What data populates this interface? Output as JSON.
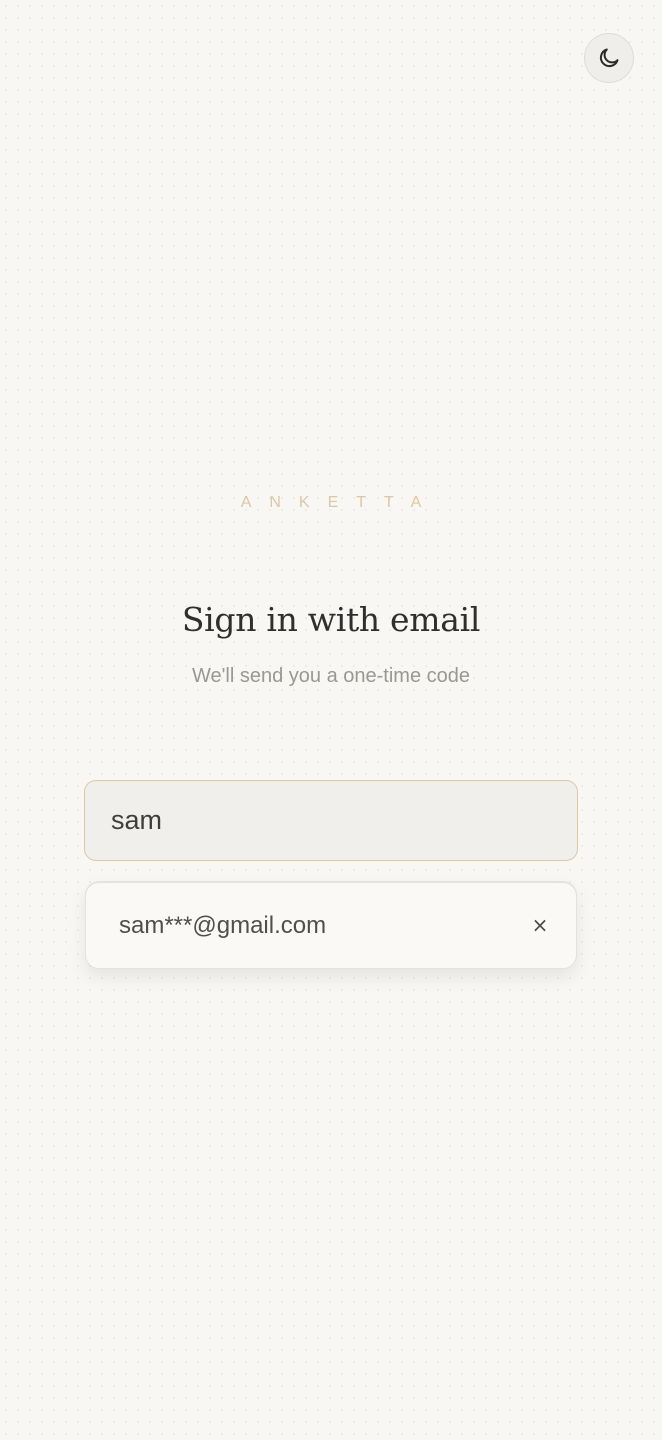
{
  "header": {
    "theme_toggle_icon": "moon-icon"
  },
  "brand": {
    "name": "ANKETTA",
    "color": "#ddc8a5"
  },
  "signin": {
    "title": "Sign in with email",
    "subtitle": "We'll send you a one-time code"
  },
  "email_input": {
    "value": "sam"
  },
  "suggestions": {
    "items": [
      {
        "label": "sam***@gmail.com",
        "remove_label": "×",
        "remove_icon": "close-icon"
      }
    ]
  },
  "colors": {
    "background": "#f8f7f4",
    "accent": "#dcc7a6",
    "title": "#2f2f2f",
    "muted": "#999893"
  }
}
